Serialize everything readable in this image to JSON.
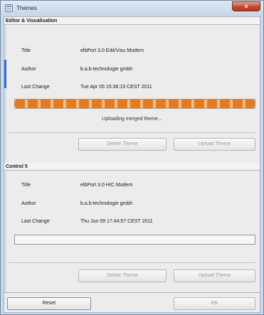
{
  "window": {
    "title": "Themes",
    "close_glyph": "×",
    "icon": "themes-window-icon"
  },
  "sections": [
    {
      "header": "Editor & Visualisation",
      "labels": {
        "title": "Title",
        "author": "Author",
        "last_change": "Last Change"
      },
      "values": {
        "title": "elbPort 3.0 Edit/Visu Modern",
        "author": "b.a.b-technologie gmbh",
        "last_change": "Tue Apr 05 15:36:19 CEST 2011"
      },
      "progress": 1.0,
      "status": "Uploading merged theme...",
      "delete_label": "Delete Theme",
      "upload_label": "Upload Theme"
    },
    {
      "header": "Control 5",
      "labels": {
        "title": "Title",
        "author": "Author",
        "last_change": "Last Change"
      },
      "values": {
        "title": "elbPort 3.0 HIC Modern",
        "author": "b.a.b-technologie gmbh",
        "last_change": "Thu Jun 09 17:44:57 CEST 2011"
      },
      "progress": 0,
      "status": "",
      "delete_label": "Delete Theme",
      "upload_label": "Upload Theme"
    }
  ],
  "footer": {
    "reset_label": "Reset",
    "ok_label": "OK"
  },
  "colors": {
    "progress_orange": "#e97a1a",
    "close_red": "#c9442a",
    "scroll_blue": "#2f6fd0"
  }
}
